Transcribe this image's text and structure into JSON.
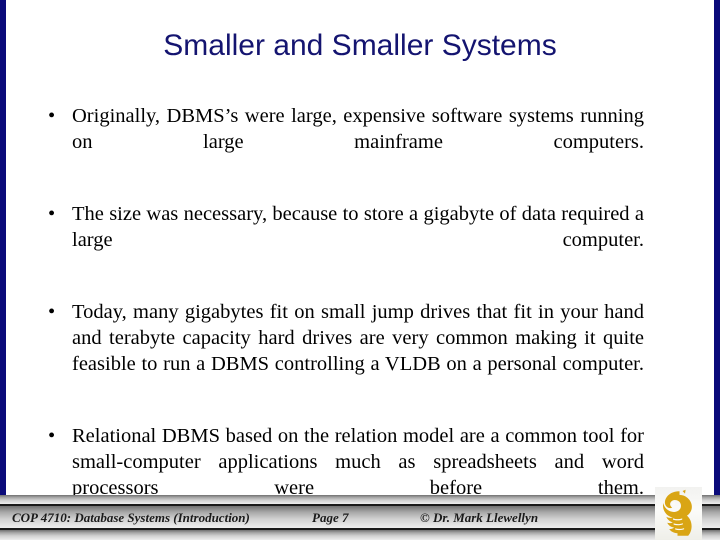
{
  "slide": {
    "title": "Smaller and Smaller Systems",
    "accent_color": "#141470",
    "background_color": "#ffffff",
    "bullets": [
      {
        "marker": "•",
        "text": "Originally, DBMS’s were large, expensive software systems running on large mainframe computers."
      },
      {
        "marker": "•",
        "text": "The size was necessary, because to store a gigabyte of data required a large computer."
      },
      {
        "marker": "•",
        "text": "Today, many gigabytes fit on small jump drives that fit in your hand and terabyte capacity hard drives are very common making it quite feasible to run a DBMS controlling a VLDB on a personal computer."
      },
      {
        "marker": "•",
        "text": "Relational DBMS based on the relation model are a common tool for small-computer applications much as spreadsheets and word processors were before them."
      }
    ]
  },
  "footer": {
    "course": "COP 4710: Database Systems  (Introduction)",
    "page": "Page 7",
    "copyright": "©  Dr. Mark Llewellyn",
    "logo_name": "ucf-pegasus-logo",
    "logo_color": "#d9a514"
  }
}
